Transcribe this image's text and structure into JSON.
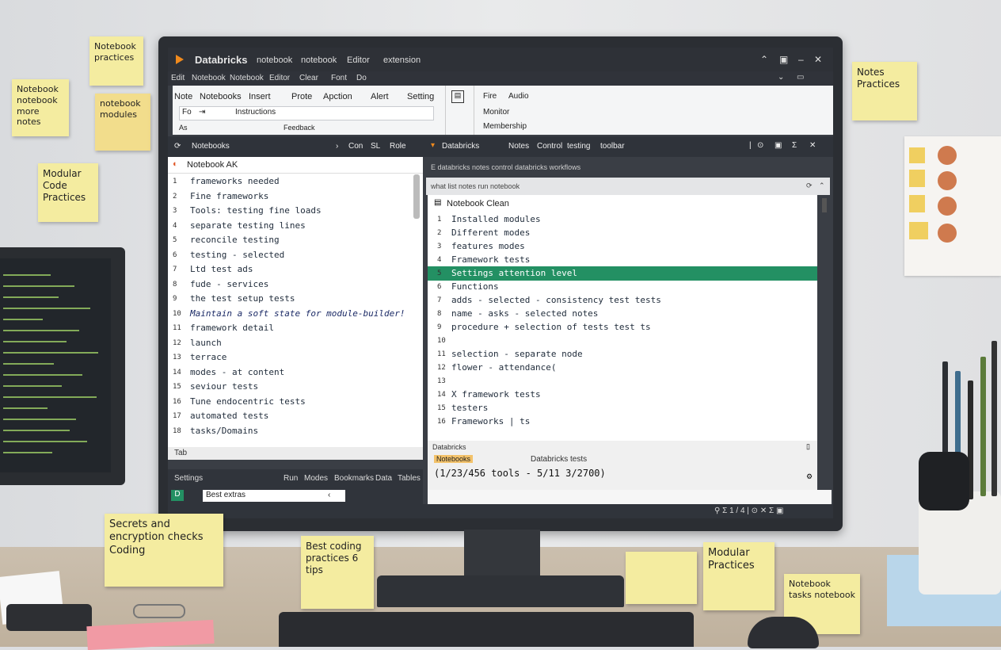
{
  "window": {
    "app_name": "Databricks",
    "menu_top": [
      "notebook",
      "notebook",
      "Editor",
      "extension"
    ],
    "menu_second": [
      "Edit",
      "Notebook",
      "Notebook",
      "Editor",
      "Clear",
      "Font",
      "Do"
    ],
    "win_controls": [
      "⌃",
      "▣",
      "–",
      "✕"
    ]
  },
  "ribbon": {
    "tabs": [
      "Note",
      "Notebooks",
      "Insert",
      "Prote",
      "Apction",
      "Alert",
      "Setting"
    ],
    "input_prefix": "Fo",
    "input_value": "Instructions",
    "row3_labels": [
      "As",
      "Feedback"
    ],
    "side_labels": [
      "Fire",
      "Audio",
      "Monitor",
      "Membership"
    ]
  },
  "left_pane": {
    "header": "Notebooks",
    "header_right": [
      "Con",
      "SL",
      "Role"
    ],
    "file_title": "Notebook AK",
    "lines": [
      {
        "n": "1",
        "t": "frameworks needed"
      },
      {
        "n": "2",
        "t": "Fine frameworks"
      },
      {
        "n": "3",
        "t": "  Tools: testing fine loads"
      },
      {
        "n": "4",
        "t": "    separate testing lines"
      },
      {
        "n": "5",
        "t": "    reconcile testing"
      },
      {
        "n": "6",
        "t": "    testing - selected"
      },
      {
        "n": "7",
        "t": "     Ltd test ads"
      },
      {
        "n": "8",
        "t": "     fude - services"
      },
      {
        "n": "9",
        "t": "    the test setup tests"
      },
      {
        "n": "10",
        "t": "Maintain a soft state for module-builder!"
      },
      {
        "n": "11",
        "t": "  framework detail"
      },
      {
        "n": "12",
        "t": "  launch"
      },
      {
        "n": "13",
        "t": "  terrace"
      },
      {
        "n": "14",
        "t": "  modes - at content"
      },
      {
        "n": "15",
        "t": "    seviour tests"
      },
      {
        "n": "16",
        "t": "    Tune endocentric tests"
      },
      {
        "n": "17",
        "t": "    automated tests"
      },
      {
        "n": "18",
        "t": "    tasks/Domains"
      }
    ],
    "footer": "Tab",
    "bottom_bar": [
      "Settings",
      "Run",
      "Modes",
      "Bookmarks",
      "Data",
      "Tables"
    ],
    "bottom_input": "Best extras"
  },
  "right_pane": {
    "header": "Databricks",
    "header_mid": [
      "Notes",
      "Control",
      "testing",
      "toolbar"
    ],
    "header_right": [
      "|",
      "⊙",
      "▣",
      "Σ",
      "✕"
    ],
    "sub1": "E  databricks notes  control  databricks workflows",
    "sub2": "what  list notes  run  notebook",
    "file_title": "Notebook Clean",
    "lines": [
      {
        "n": "1",
        "t": "Installed modules"
      },
      {
        "n": "2",
        "t": "Different modes"
      },
      {
        "n": "3",
        "t": "features modes"
      },
      {
        "n": "4",
        "t": "Framework tests"
      },
      {
        "n": "5",
        "t": "Settings attention level"
      },
      {
        "n": "6",
        "t": "Functions"
      },
      {
        "n": "7",
        "t": "  adds - selected - consistency test tests"
      },
      {
        "n": "8",
        "t": "    name - asks - selected notes"
      },
      {
        "n": "9",
        "t": "    procedure + selection of tests test ts"
      },
      {
        "n": "10",
        "t": ""
      },
      {
        "n": "11",
        "t": "    selection - separate node"
      },
      {
        "n": "12",
        "t": "    flower - attendance("
      },
      {
        "n": "13",
        "t": ""
      },
      {
        "n": "14",
        "t": "  X framework tests"
      },
      {
        "n": "15",
        "t": "  testers"
      },
      {
        "n": "16",
        "t": "  Frameworks | ts"
      }
    ],
    "highlight_index": 4,
    "footer_label": "Databricks",
    "output_tag": "Notebooks",
    "output_title": "Databricks tests",
    "output_value": "(1/23/456 tools - 5/11 3/2700)",
    "status": "⚲ Σ 1 / 4  |  ⊙ ✕  Σ ▣"
  },
  "notes": {
    "n1": "Notebook practices",
    "n2": "Notebook notebook more notes",
    "n3": "notebook modules",
    "n4": "Modular Code Practices",
    "n5": "Notes Practices",
    "n6": "Secrets and encryption checks Coding",
    "n7": "Best coding practices 6 tips",
    "n8": "Modular Practices",
    "n9": "Notebook tasks notebook"
  },
  "colors": {
    "accent_green": "#239063",
    "brand_orange": "#f08a1d",
    "sticky_yellow": "#f4eca0"
  }
}
